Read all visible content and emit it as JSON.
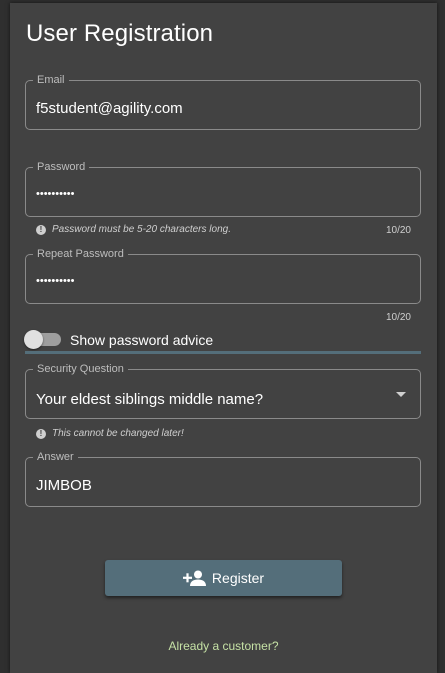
{
  "title": "User Registration",
  "email": {
    "label": "Email",
    "value": "f5student@agility.com"
  },
  "password": {
    "label": "Password",
    "value": "••••••••••",
    "hint": "Password must be 5-20 characters long.",
    "counter": "10/20"
  },
  "repeat_password": {
    "label": "Repeat Password",
    "value": "••••••••••",
    "counter": "10/20"
  },
  "advice_toggle": {
    "label": "Show password advice"
  },
  "security_question": {
    "label": "Security Question",
    "value": "Your eldest siblings middle name?",
    "hint": "This cannot be changed later!"
  },
  "answer": {
    "label": "Answer",
    "value": "JIMBOB"
  },
  "register_button": {
    "label": "Register",
    "icon": "person-add-icon"
  },
  "login_link": "Already a customer?",
  "colors": {
    "background": "#2f2f2f",
    "card": "#424242",
    "primary_button": "#546e7a",
    "link": "#c5e1a5"
  }
}
